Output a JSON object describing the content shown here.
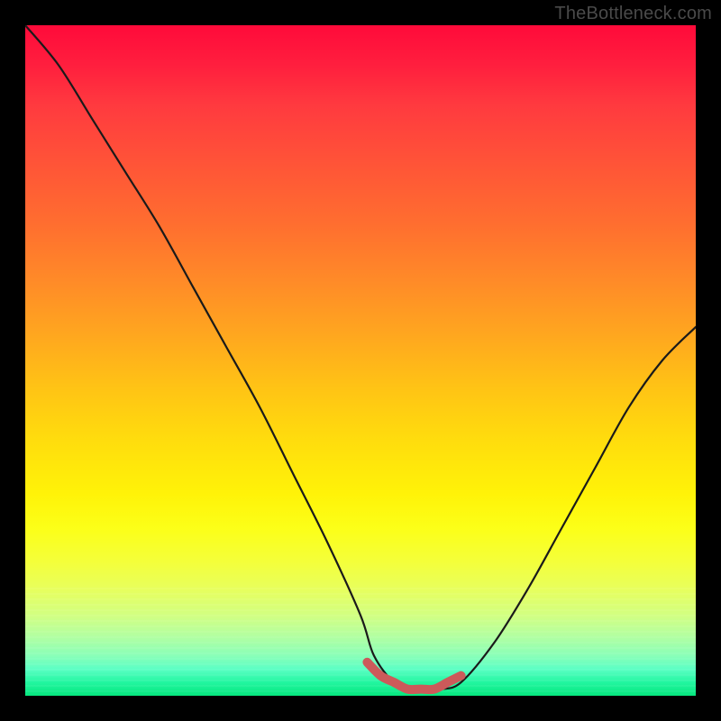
{
  "watermark": "TheBottleneck.com",
  "colors": {
    "background": "#000000",
    "curve_main": "#1a1a1a",
    "curve_thick": "#cc5a5a",
    "gradient_top": "#ff0a3a",
    "gradient_bottom": "#06e77e"
  },
  "chart_data": {
    "type": "line",
    "title": "",
    "xlabel": "",
    "ylabel": "",
    "xlim": [
      0,
      100
    ],
    "ylim": [
      0,
      100
    ],
    "series": [
      {
        "name": "bottleneck-curve",
        "comment": "V-shaped curve; y≈0 means no bottleneck (green zone). Values estimated from pixel positions.",
        "x": [
          0,
          5,
          10,
          15,
          20,
          25,
          30,
          35,
          40,
          45,
          50,
          52,
          55,
          58,
          60,
          62,
          65,
          70,
          75,
          80,
          85,
          90,
          95,
          100
        ],
        "y": [
          100,
          94,
          86,
          78,
          70,
          61,
          52,
          43,
          33,
          23,
          12,
          6,
          2,
          1,
          1,
          1,
          2,
          8,
          16,
          25,
          34,
          43,
          50,
          55
        ]
      },
      {
        "name": "optimal-range-highlight",
        "comment": "Thick desaturated-red segment marking the flat minimum (optimal, near-zero bottleneck).",
        "x": [
          51,
          53,
          55,
          57,
          59,
          61,
          63,
          65
        ],
        "y": [
          5,
          3,
          2,
          1,
          1,
          1,
          2,
          3
        ]
      }
    ]
  }
}
